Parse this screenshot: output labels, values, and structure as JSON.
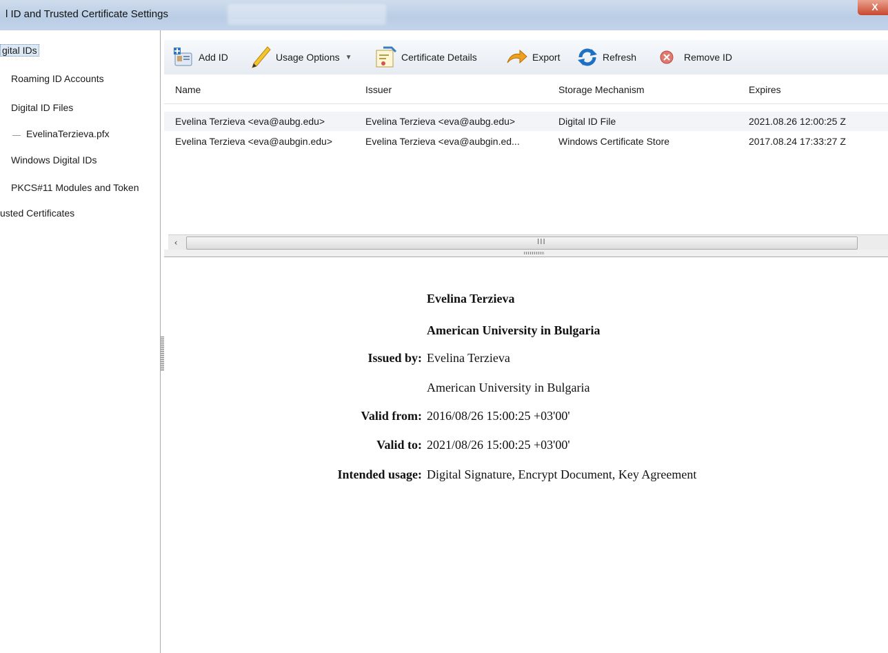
{
  "window": {
    "title": "l ID and Trusted Certificate Settings",
    "close_label": "X"
  },
  "sidebar": {
    "items": [
      {
        "label": "gital IDs",
        "selected": true
      },
      {
        "label": "Roaming ID Accounts"
      },
      {
        "label": "Digital ID Files"
      },
      {
        "label": "EvelinaTerzieva.pfx"
      },
      {
        "label": "Windows Digital IDs"
      },
      {
        "label": "PKCS#11 Modules and Token"
      },
      {
        "label": "usted Certificates"
      }
    ]
  },
  "toolbar": {
    "add_id": "Add ID",
    "usage_options": "Usage Options",
    "certificate_details": "Certificate Details",
    "export": "Export",
    "refresh": "Refresh",
    "remove_id": "Remove ID"
  },
  "table": {
    "columns": [
      "Name",
      "Issuer",
      "Storage Mechanism",
      "Expires"
    ],
    "rows": [
      [
        "Evelina Terzieva <eva@aubg.edu>",
        "Evelina Terzieva <eva@aubg.edu>",
        "Digital ID File",
        "2021.08.26 12:00:25 Z"
      ],
      [
        "Evelina Terzieva <eva@aubgin.edu>",
        "Evelina Terzieva <eva@aubgin.ed...",
        "Windows Certificate Store",
        "2017.08.24 17:33:27 Z"
      ]
    ]
  },
  "scrollbar": {
    "left_arrow": "‹",
    "grip": "III"
  },
  "details": {
    "name": "Evelina Terzieva",
    "organization": "American University in Bulgaria",
    "issued_by_label": "Issued by:",
    "issued_by_name": "Evelina Terzieva",
    "issued_by_org": "American University in Bulgaria",
    "valid_from_label": "Valid from:",
    "valid_from": "2016/08/26 15:00:25 +03'00'",
    "valid_to_label": "Valid to:",
    "valid_to": "2021/08/26 15:00:25 +03'00'",
    "intended_usage_label": "Intended usage:",
    "intended_usage": "Digital Signature, Encrypt Document, Key Agreement"
  },
  "colors": {
    "titlebar": "#c3d4ea",
    "close": "#c9472e",
    "selected_row": "#dde8f5"
  }
}
